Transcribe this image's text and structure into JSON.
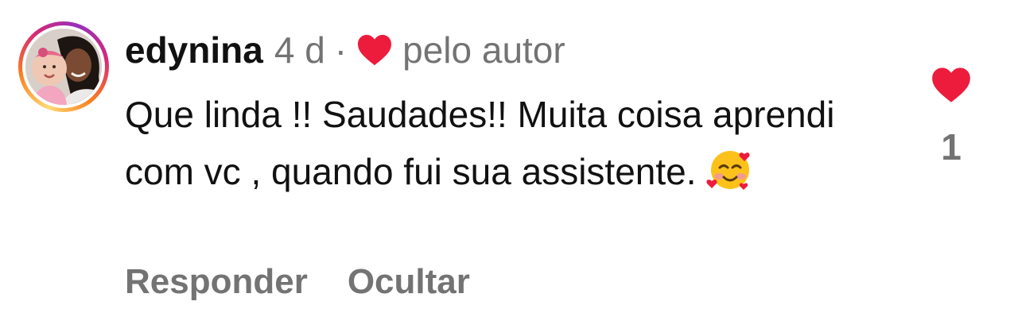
{
  "comment": {
    "username": "edynina",
    "age": "4 d",
    "separator": "·",
    "liked_by_author_text": "pelo autor",
    "text": "Que linda !! Saudades!! Muita coisa aprendi com vc , quando fui sua assistente.",
    "emoji": "smiling-face-with-hearts",
    "like_count": "1",
    "liked": true
  },
  "actions": {
    "reply_label": "Responder",
    "hide_label": "Ocultar"
  },
  "colors": {
    "heart": "#ed1c3c",
    "secondary_text": "#737373",
    "primary_text": "#111111"
  }
}
